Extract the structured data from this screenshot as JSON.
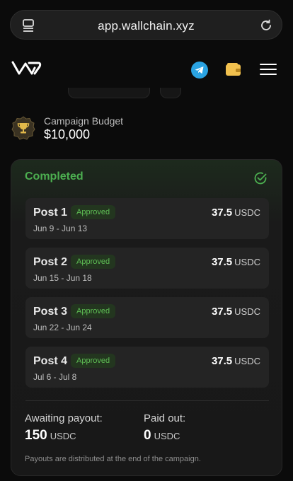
{
  "browser": {
    "url": "app.wallchain.xyz"
  },
  "nav": {
    "icons": [
      "wallchain-logo-icon",
      "telegram-icon",
      "wallet-icon",
      "menu-icon"
    ]
  },
  "campaign": {
    "budget_label": "Campaign Budget",
    "budget_value": "$10,000"
  },
  "card": {
    "status": "Completed",
    "posts": [
      {
        "title": "Post 1",
        "badge": "Approved",
        "dates": "Jun 9 - Jun 13",
        "amount": "37.5",
        "currency": "USDC"
      },
      {
        "title": "Post 2",
        "badge": "Approved",
        "dates": "Jun 15 - Jun 18",
        "amount": "37.5",
        "currency": "USDC"
      },
      {
        "title": "Post 3",
        "badge": "Approved",
        "dates": "Jun 22 - Jun 24",
        "amount": "37.5",
        "currency": "USDC"
      },
      {
        "title": "Post 4",
        "badge": "Approved",
        "dates": "Jul 6 - Jul 8",
        "amount": "37.5",
        "currency": "USDC"
      }
    ],
    "awaiting_label": "Awaiting payout:",
    "awaiting_value": "150",
    "awaiting_currency": "USDC",
    "paid_label": "Paid out:",
    "paid_value": "0",
    "paid_currency": "USDC",
    "note": "Payouts are distributed at the end of the campaign."
  },
  "colors": {
    "accent_green": "#4caf50",
    "badge_green": "#5fbf55",
    "telegram_blue": "#2aa3e2",
    "wallet_yellow": "#f2c14e"
  }
}
